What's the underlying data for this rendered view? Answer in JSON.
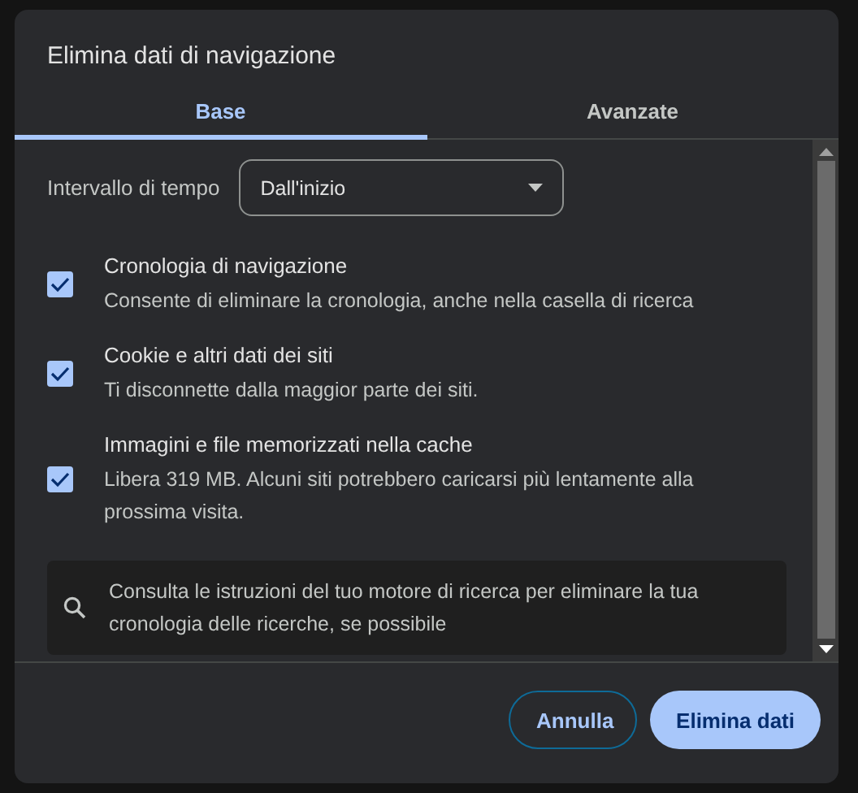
{
  "dialog": {
    "title": "Elimina dati di navigazione"
  },
  "tabs": [
    {
      "label": "Base",
      "selected": true
    },
    {
      "label": "Avanzate",
      "selected": false
    }
  ],
  "time_range": {
    "label": "Intervallo di tempo",
    "value": "Dall'inizio"
  },
  "options": [
    {
      "title": "Cronologia di navigazione",
      "description": "Consente di eliminare la cronologia, anche nella casella di ricerca",
      "checked": true
    },
    {
      "title": "Cookie e altri dati dei siti",
      "description": "Ti disconnette dalla maggior parte dei siti.",
      "checked": true
    },
    {
      "title": "Immagini e file memorizzati nella cache",
      "description": "Libera 319 MB. Alcuni siti potrebbero caricarsi più lentamente alla prossima visita.",
      "checked": true
    }
  ],
  "notice": {
    "text": "Consulta le istruzioni del tuo motore di ricerca per eliminare la tua cronologia delle ricerche, se possibile"
  },
  "buttons": [
    {
      "label": "Annulla",
      "kind": "outline"
    },
    {
      "label": "Elimina dati",
      "kind": "primary"
    }
  ]
}
